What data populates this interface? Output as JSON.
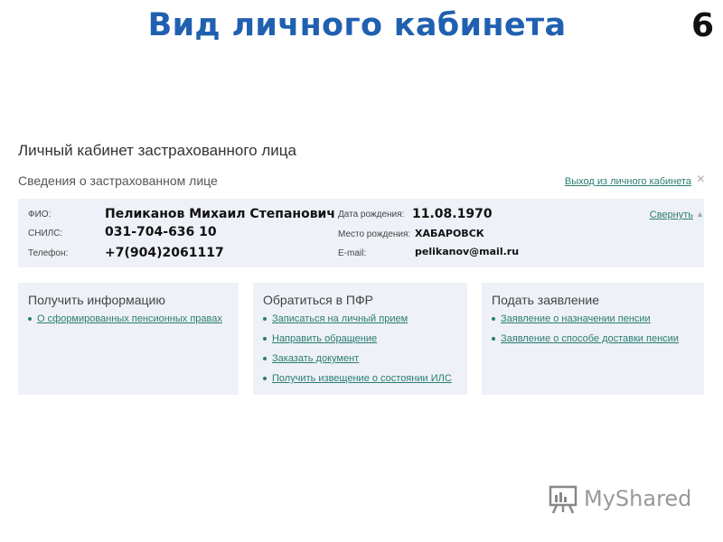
{
  "slide": {
    "title": "Вид личного кабинета",
    "number": "6"
  },
  "cabinet": {
    "title": "Личный кабинет застрахованного лица",
    "section_title": "Сведения о застрахованном лице",
    "logout_link": "Выход из личного кабинета",
    "close_icon": "×"
  },
  "person": {
    "fio_label": "ФИО:",
    "fio_value": "Пеликанов Михаил Степанович",
    "snils_label": "СНИЛС:",
    "snils_value": "031-704-636 10",
    "phone_label": "Телефон:",
    "phone_value": "+7(904)2061117",
    "birth_date_label": "Дата рождения:",
    "birth_date_value": "11.08.1970",
    "birth_place_label": "Место рождения:",
    "birth_place_value": "ХАБАРОВСК",
    "email_label": "E-mail:",
    "email_value": "pelikanov@mail.ru",
    "collapse_link": "Свернуть",
    "collapse_icon": "▲"
  },
  "cards": [
    {
      "title": "Получить информацию",
      "links": [
        "О сформированных пенсионных правах"
      ]
    },
    {
      "title": "Обратиться в ПФР",
      "links": [
        "Записаться на личный прием",
        "Направить обращение",
        "Заказать документ",
        "Получить извещение о состоянии ИЛС"
      ]
    },
    {
      "title": "Подать заявление",
      "links": [
        "Заявление о назначении пенсии",
        "Заявление о способе доставки пенсии"
      ]
    }
  ],
  "watermark": {
    "text": "MyShared",
    "icon": "presentation-board-icon"
  },
  "colors": {
    "title": "#2060b0",
    "link": "#2a7d6f",
    "panel_bg": "#eef1f7"
  }
}
